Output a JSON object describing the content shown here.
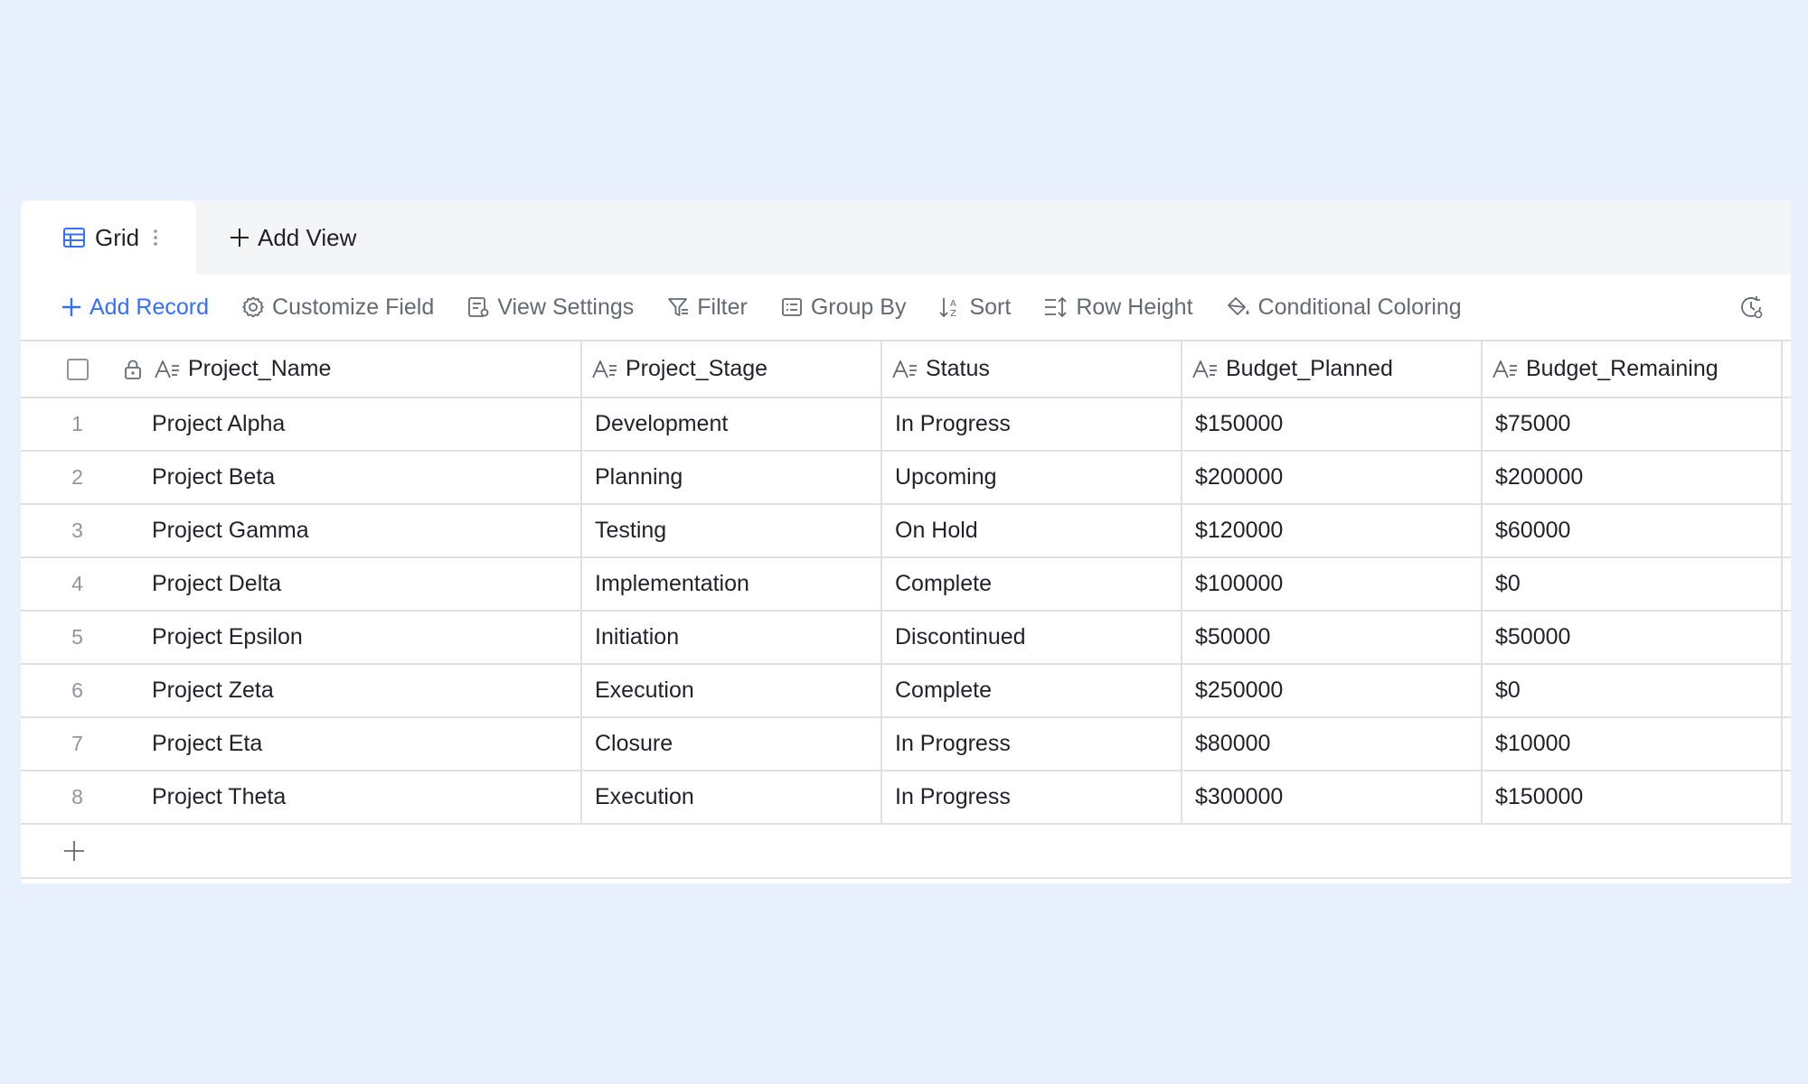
{
  "tabs": {
    "grid_label": "Grid",
    "add_view_label": "Add View"
  },
  "toolbar": {
    "add_record": "Add Record",
    "customize_field": "Customize Field",
    "view_settings": "View Settings",
    "filter": "Filter",
    "group_by": "Group By",
    "sort": "Sort",
    "row_height": "Row Height",
    "conditional_coloring": "Conditional Coloring"
  },
  "columns": [
    "Project_Name",
    "Project_Stage",
    "Status",
    "Budget_Planned",
    "Budget_Remaining"
  ],
  "rows": [
    {
      "index": "1",
      "name": "Project Alpha",
      "stage": "Development",
      "status": "In Progress",
      "planned": "$150000",
      "remaining": "$75000"
    },
    {
      "index": "2",
      "name": "Project Beta",
      "stage": "Planning",
      "status": "Upcoming",
      "planned": "$200000",
      "remaining": "$200000"
    },
    {
      "index": "3",
      "name": "Project Gamma",
      "stage": "Testing",
      "status": "On Hold",
      "planned": "$120000",
      "remaining": "$60000"
    },
    {
      "index": "4",
      "name": "Project Delta",
      "stage": "Implementation",
      "status": "Complete",
      "planned": "$100000",
      "remaining": "$0"
    },
    {
      "index": "5",
      "name": "Project Epsilon",
      "stage": "Initiation",
      "status": "Discontinued",
      "planned": "$50000",
      "remaining": "$50000"
    },
    {
      "index": "6",
      "name": "Project Zeta",
      "stage": "Execution",
      "status": "Complete",
      "planned": "$250000",
      "remaining": "$0"
    },
    {
      "index": "7",
      "name": "Project Eta",
      "stage": "Closure",
      "status": "In Progress",
      "planned": "$80000",
      "remaining": "$10000"
    },
    {
      "index": "8",
      "name": "Project Theta",
      "stage": "Execution",
      "status": "In Progress",
      "planned": "$300000",
      "remaining": "$150000"
    }
  ],
  "colors": {
    "accent": "#3370ff",
    "muted_text": "#646a73",
    "border": "#dee0e3",
    "page_background": "#e8effd"
  }
}
